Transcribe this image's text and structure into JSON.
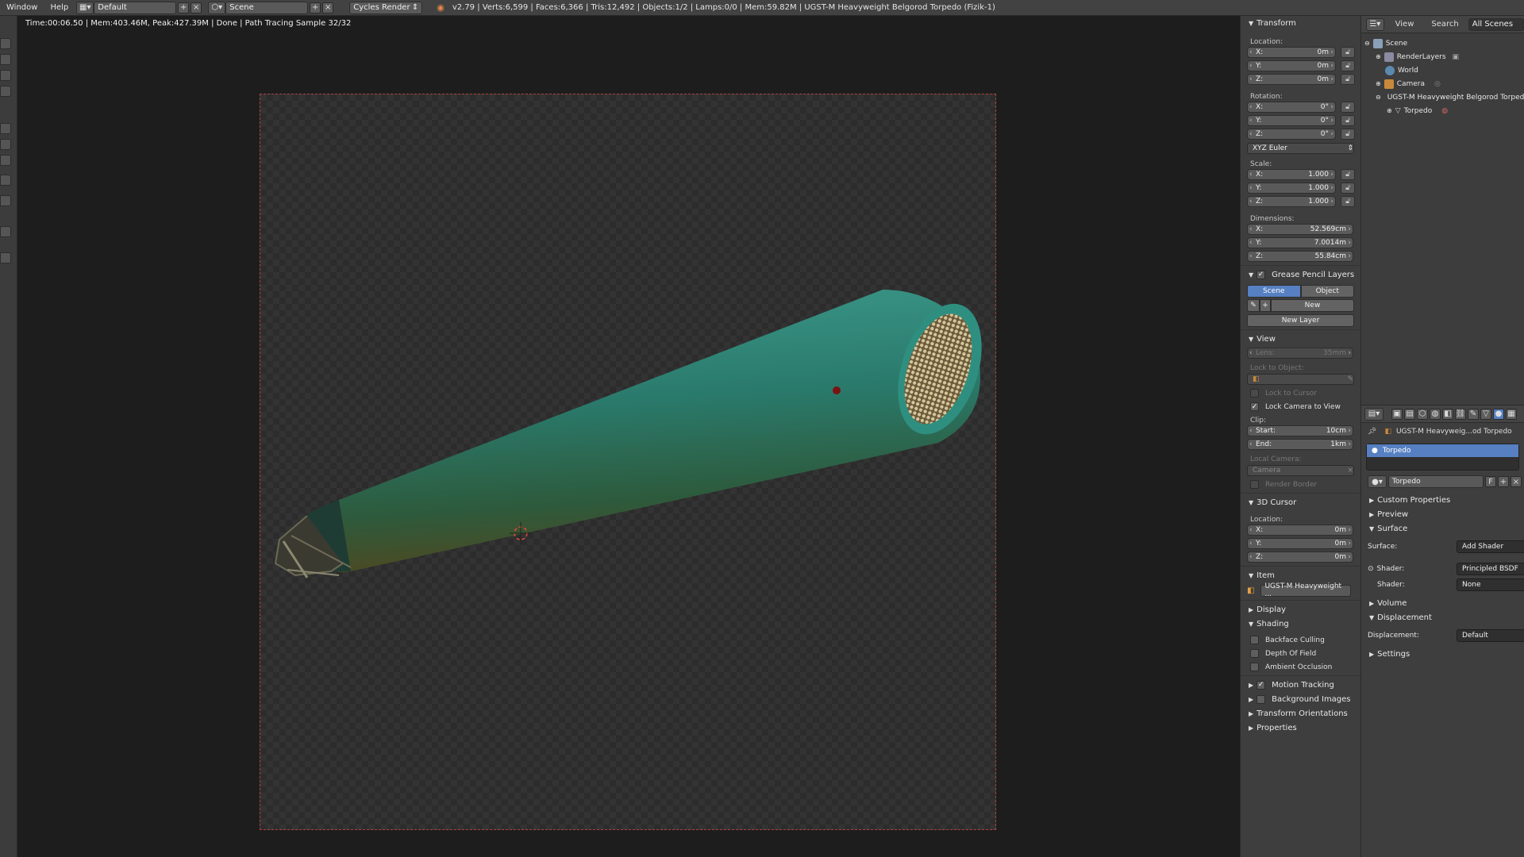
{
  "topbar": {
    "menu_window": "Window",
    "menu_help": "Help",
    "layout_name": "Default",
    "scene_name": "Scene",
    "engine": "Cycles Render",
    "stats": "v2.79 | Verts:6,599 | Faces:6,366 | Tris:12,492 | Objects:1/2 | Lamps:0/0 | Mem:59.82M | UGST-M Heavyweight Belgorod Torpedo (Fizik-1)"
  },
  "viewport": {
    "render_info": "Time:00:06.50 | Mem:403.46M, Peak:427.39M | Done | Path Tracing Sample 32/32"
  },
  "npanel": {
    "transform": {
      "title": "Transform",
      "location_label": "Location:",
      "location": [
        {
          "axis": "X:",
          "value": "0m"
        },
        {
          "axis": "Y:",
          "value": "0m"
        },
        {
          "axis": "Z:",
          "value": "0m"
        }
      ],
      "rotation_label": "Rotation:",
      "rotation": [
        {
          "axis": "X:",
          "value": "0°"
        },
        {
          "axis": "Y:",
          "value": "0°"
        },
        {
          "axis": "Z:",
          "value": "0°"
        }
      ],
      "rotation_mode": "XYZ Euler",
      "scale_label": "Scale:",
      "scale": [
        {
          "axis": "X:",
          "value": "1.000"
        },
        {
          "axis": "Y:",
          "value": "1.000"
        },
        {
          "axis": "Z:",
          "value": "1.000"
        }
      ],
      "dimensions_label": "Dimensions:",
      "dimensions": [
        {
          "axis": "X:",
          "value": "52.569cm"
        },
        {
          "axis": "Y:",
          "value": "7.0014m"
        },
        {
          "axis": "Z:",
          "value": "55.84cm"
        }
      ]
    },
    "grease_pencil": {
      "title": "Grease Pencil Layers",
      "scene_tab": "Scene",
      "object_tab": "Object",
      "new_label": "New",
      "new_layer_label": "New Layer"
    },
    "view": {
      "title": "View",
      "lens_label": "Lens:",
      "lens_value": "35mm",
      "lock_to_object": "Lock to Object:",
      "lock_to_cursor": "Lock to Cursor",
      "lock_camera": "Lock Camera to View",
      "clip_label": "Clip:",
      "clip_start_label": "Start:",
      "clip_start": "10cm",
      "clip_end_label": "End:",
      "clip_end": "1km",
      "local_camera": "Local Camera:",
      "camera_value": "Camera",
      "render_border": "Render Border"
    },
    "cursor": {
      "title": "3D Cursor",
      "location_label": "Location:",
      "location": [
        {
          "axis": "X:",
          "value": "0m"
        },
        {
          "axis": "Y:",
          "value": "0m"
        },
        {
          "axis": "Z:",
          "value": "0m"
        }
      ]
    },
    "item": {
      "title": "Item",
      "name": "UGST-M Heavyweight ..."
    },
    "display_title": "Display",
    "shading": {
      "title": "Shading",
      "backface": "Backface Culling",
      "dof": "Depth Of Field",
      "ao": "Ambient Occlusion"
    },
    "motion_tracking": "Motion Tracking",
    "background_images": "Background Images",
    "transform_orientations": "Transform Orientations",
    "properties": "Properties"
  },
  "outliner": {
    "view": "View",
    "search": "Search",
    "all_scenes": "All Scenes",
    "items": [
      "Scene",
      "RenderLayers",
      "World",
      "Camera",
      "UGST-M Heavyweight Belgorod Torpedo",
      "Torpedo"
    ]
  },
  "props": {
    "breadcrumb": "UGST-M Heavyweig...od Torpedo",
    "material_slot": "Torpedo",
    "material_name": "Torpedo",
    "fake_user": "F",
    "custom_properties": "Custom Properties",
    "preview": "Preview",
    "surface_title": "Surface",
    "surface_label": "Surface:",
    "surface_value": "Add Shader",
    "shader1_label": "Shader:",
    "shader1_value": "Principled BSDF",
    "shader2_label": "Shader:",
    "shader2_value": "None",
    "volume": "Volume",
    "displacement_title": "Displacement",
    "displacement_label": "Displacement:",
    "displacement_value": "Default",
    "settings": "Settings"
  },
  "colors": {
    "accent": "#5680c2",
    "torpedo": "#2f8a7c",
    "render_border": "#b04040"
  }
}
